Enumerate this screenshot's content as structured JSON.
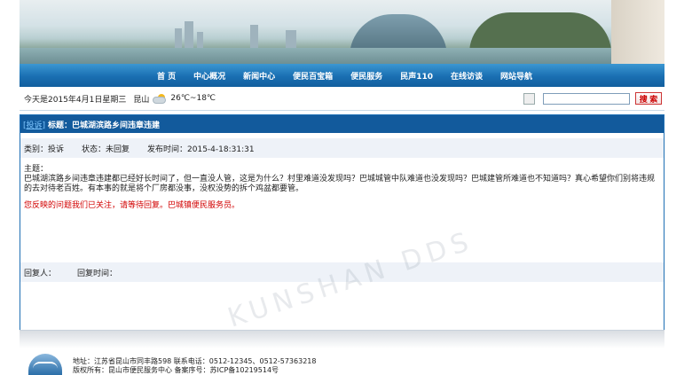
{
  "nav": {
    "items": [
      "首 页",
      "中心概况",
      "新闻中心",
      "便民百宝箱",
      "便民服务",
      "民声110",
      "在线访谈",
      "网站导航"
    ]
  },
  "infobar": {
    "date": "今天是2015年4月1日星期三",
    "city": "昆山",
    "weather_icon": "partly-cloudy-icon",
    "temp": "26℃~18℃",
    "search_placeholder": "",
    "search_button": "搜 索"
  },
  "article": {
    "tag": "[投诉]",
    "title": "标题：巴城湖滨路乡间违章违建",
    "category": "类别：投诉",
    "status": "状态：未回复",
    "published": "发布时间：2015-4-18:31:31",
    "subject_label": "主题：",
    "content": "巴城湖滨路乡间违章违建都已经好长时间了，但一直没人管，这是为什么？村里难道没发现吗？巴城城管中队难道也没发现吗？巴城建管所难道也不知道吗？真心希望你们别将违规的去对待老百姓。有本事的就是将个厂房都没事，没权没势的拆个鸡盆都要管。",
    "note": "您反映的问题我们已关注，请等待回复。巴城镇便民服务员。"
  },
  "reply": {
    "replier_label": "回复人：",
    "reply_time_label": "回复时间："
  },
  "watermark": "KUNSHAN DDS",
  "footer": {
    "address": "地址：江苏省昆山市同丰路598  联系电话：0512-12345、0512-57363218",
    "copyright": "版权所有：昆山市便民服务中心  备案序号：苏ICP备10219514号"
  },
  "colors": {
    "nav": "#1a6fb2",
    "panel_head": "#125a9c",
    "note": "#d20000"
  }
}
